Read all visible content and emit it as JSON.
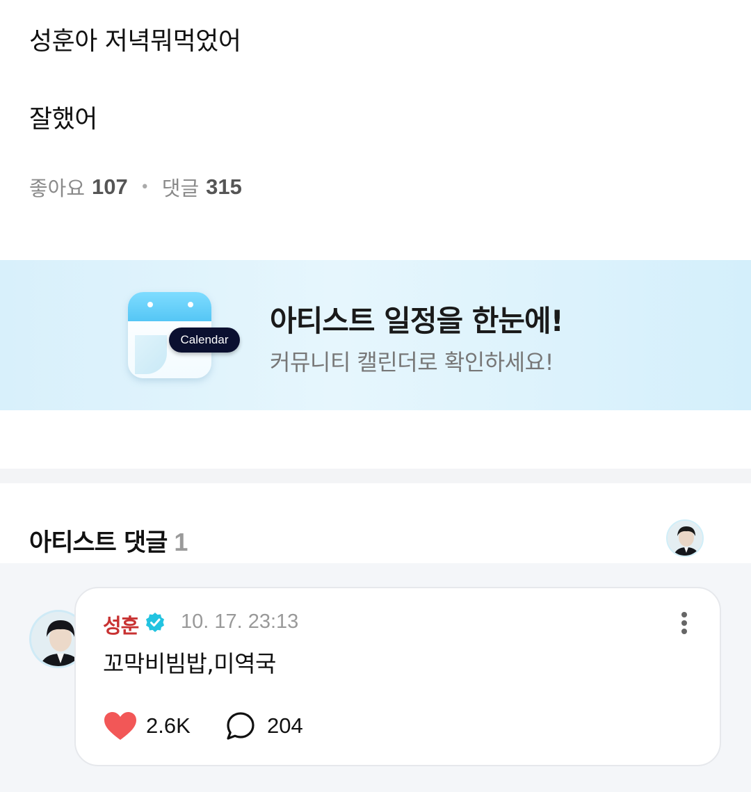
{
  "post": {
    "line1": "성훈아 저녁뭐먹었어",
    "line2": "잘했어",
    "likes_label": "좋아요",
    "likes_count": "107",
    "comments_label": "댓글",
    "comments_count": "315"
  },
  "banner": {
    "pill_label": "Calendar",
    "title": "아티스트 일정을 한눈에!",
    "subtitle": "커뮤니티 캘린더로 확인하세요!"
  },
  "artist_comments": {
    "title": "아티스트 댓글",
    "count": "1"
  },
  "comment": {
    "author": "성훈",
    "timestamp": "10. 17. 23:13",
    "text": "꼬막비빔밥,미역국",
    "likes": "2.6K",
    "replies": "204"
  },
  "icons": {
    "like": "heart-icon",
    "reply": "speech-bubble-icon",
    "verified": "verified-badge-icon",
    "more": "more-vertical-icon"
  },
  "colors": {
    "author": "#c83232",
    "verified": "#22c3e0",
    "heart": "#f25757"
  }
}
